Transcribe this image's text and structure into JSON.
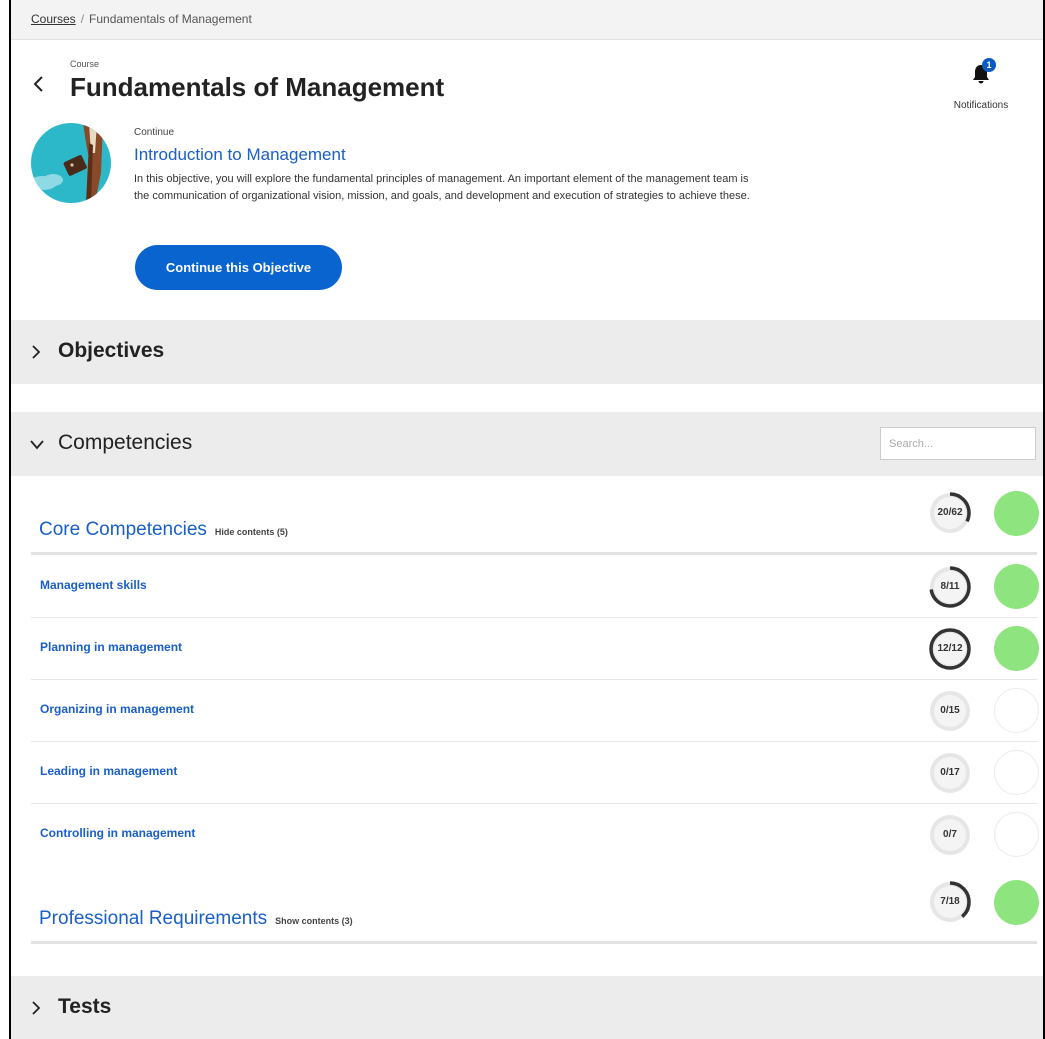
{
  "breadcrumb": {
    "root": "Courses",
    "separator": "/",
    "current": "Fundamentals of Management"
  },
  "header": {
    "course_tag": "Course",
    "title": "Fundamentals of Management",
    "notifications_label": "Notifications",
    "notifications_count": "1"
  },
  "continue": {
    "label": "Continue",
    "objective": "Introduction to Management",
    "description": "In this objective, you will explore the fundamental principles of management. An important element of the management team is the communication of organizational vision, mission, and goals, and development and execution of strategies to achieve these.",
    "button": "Continue this Objective"
  },
  "sections": {
    "objectives": "Objectives",
    "competencies": "Competencies",
    "tests": "Tests"
  },
  "search": {
    "placeholder": "Search..."
  },
  "groups": [
    {
      "title": "Core Competencies",
      "toggle": "Hide contents (5)",
      "progress": "20/62",
      "fraction": 0.3226,
      "complete": true,
      "items": [
        {
          "name": "Management skills",
          "progress": "8/11",
          "fraction": 0.7273,
          "complete": true
        },
        {
          "name": "Planning in management",
          "progress": "12/12",
          "fraction": 1.0,
          "complete": true
        },
        {
          "name": "Organizing in management",
          "progress": "0/15",
          "fraction": 0.0,
          "complete": false
        },
        {
          "name": "Leading in management",
          "progress": "0/17",
          "fraction": 0.0,
          "complete": false
        },
        {
          "name": "Controlling in management",
          "progress": "0/7",
          "fraction": 0.0,
          "complete": false
        }
      ]
    },
    {
      "title": "Professional Requirements",
      "toggle": "Show contents (3)",
      "progress": "7/18",
      "fraction": 0.3889,
      "complete": true,
      "items": []
    }
  ],
  "colors": {
    "accent": "#1a5fc8",
    "button": "#0a64d0",
    "complete": "#8ee47e",
    "ring_track": "#e6e6e6",
    "ring_fill": "#333333"
  }
}
